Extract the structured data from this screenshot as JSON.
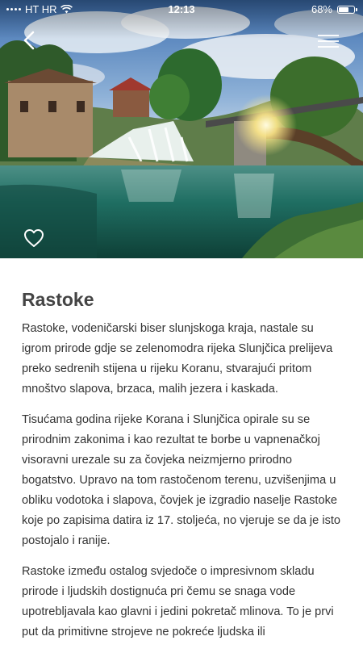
{
  "status_bar": {
    "carrier": "HT HR",
    "time": "12:13",
    "battery": "68%",
    "battery_level": 0.68,
    "signal_icon": "signal-dots-icon",
    "wifi_icon": "wifi-icon",
    "battery_icon": "battery-icon"
  },
  "hero": {
    "image": "rastoke-waterfall-photo",
    "back_icon": "chevron-left-icon",
    "menu_icon": "hamburger-menu-icon",
    "favorite_icon": "heart-outline-icon"
  },
  "article": {
    "title": "Rastoke",
    "paragraphs": [
      "Rastoke, vodeničarski biser slunjskoga kraja, nastale su igrom prirode gdje se zelenomodra rijeka Slunjčica prelijeva preko sedrenih stijena u rijeku Koranu, stvarajući pritom mnoštvo slapova, brzaca, malih jezera i kaskada.",
      "Tisućama godina rijeke Korana i Slunjčica opirale su se prirodnim zakonima i kao rezultat te borbe u vapnenačkoj visoravni urezale su za čovjeka neizmjerno prirodno bogatstvo. Upravo na tom rastočenom terenu, uzvišenjima u obliku vodotoka i slapova, čovjek je izgradio naselje Rastoke koje po zapisima datira iz 17. stoljeća, no vjeruje se da je isto postojalo i ranije.",
      "Rastoke između ostalog svjedoče o impresivnom skladu prirode i ljudskih dostignuća pri čemu se snaga vode upotrebljavala kao glavni i jedini pokretač mlinova. To je prvi put da primitivne strojeve ne pokreće ljudska ili"
    ]
  },
  "colors": {
    "title": "#444444",
    "body_text": "#333333",
    "background": "#ffffff",
    "water": "#1f6e62"
  }
}
